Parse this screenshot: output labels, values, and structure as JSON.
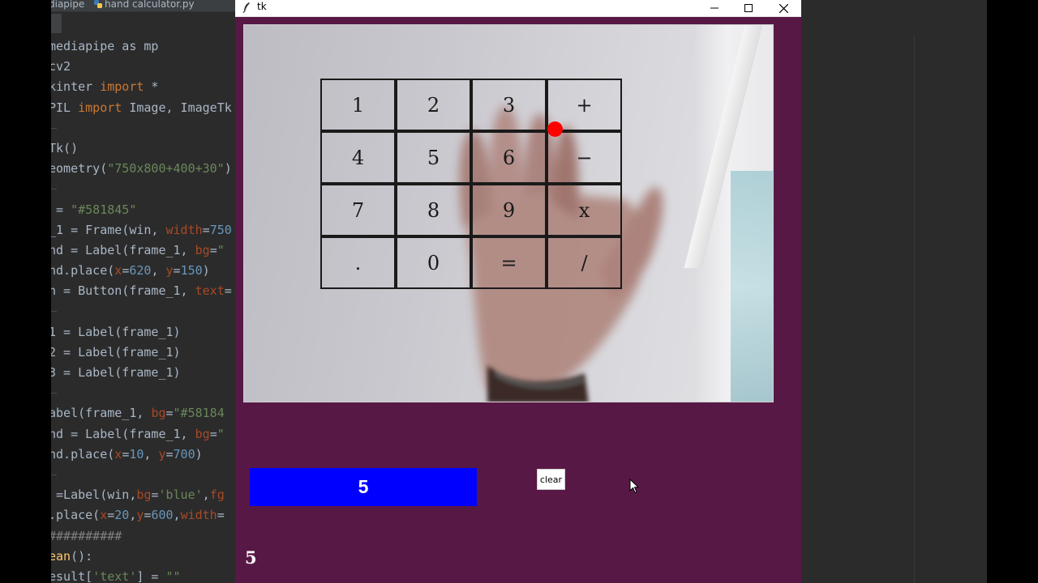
{
  "ide": {
    "tabs": [
      "diapipe",
      "hand calculator.py"
    ],
    "code_lines": [
      [
        [
          "mediapipe as mp",
          "plain"
        ],
        [
          "",
          ""
        ]
      ],
      [
        [
          "cv2",
          "plain"
        ]
      ],
      [
        [
          "kinter ",
          "plain"
        ],
        [
          "import",
          "kw"
        ],
        [
          " *",
          "plain"
        ]
      ],
      [
        [
          "PIL ",
          "plain"
        ],
        [
          "import",
          "kw"
        ],
        [
          " Image, ImageTk",
          "plain"
        ]
      ],
      [],
      [
        [
          "Tk()",
          "plain"
        ]
      ],
      [
        [
          "eometry(",
          "plain"
        ],
        [
          "\"750x800+400+30\"",
          "str"
        ],
        [
          ")",
          "plain"
        ]
      ],
      [],
      [
        [
          " = ",
          "plain"
        ],
        [
          "\"#581845\"",
          "str"
        ]
      ],
      [
        [
          "_1 = Frame(win, ",
          "plain"
        ],
        [
          "width",
          "param"
        ],
        [
          "=",
          "plain"
        ],
        [
          "750",
          "num"
        ]
      ],
      [
        [
          "nd = Label(frame_1, ",
          "plain"
        ],
        [
          "bg",
          "param"
        ],
        [
          "=",
          "plain"
        ],
        [
          "\"",
          "str"
        ]
      ],
      [
        [
          "nd.place(",
          "plain"
        ],
        [
          "x",
          "param"
        ],
        [
          "=",
          "plain"
        ],
        [
          "620",
          "num"
        ],
        [
          ", ",
          "plain"
        ],
        [
          "y",
          "param"
        ],
        [
          "=",
          "plain"
        ],
        [
          "150",
          "num"
        ],
        [
          ")",
          "plain"
        ]
      ],
      [
        [
          "n = Button(frame_1, ",
          "plain"
        ],
        [
          "text",
          "param"
        ],
        [
          "=",
          "plain"
        ]
      ],
      [],
      [
        [
          "1 = Label(frame_1)",
          "plain"
        ]
      ],
      [
        [
          "2 = Label(frame_1)",
          "plain"
        ]
      ],
      [
        [
          "3 = Label(frame_1)",
          "plain"
        ]
      ],
      [],
      [
        [
          "abel(frame_1, ",
          "plain"
        ],
        [
          "bg",
          "param"
        ],
        [
          "=",
          "plain"
        ],
        [
          "\"#58184",
          "str"
        ]
      ],
      [
        [
          "nd = Label(frame_1, ",
          "plain"
        ],
        [
          "bg",
          "param"
        ],
        [
          "=",
          "plain"
        ],
        [
          "\"",
          "str"
        ]
      ],
      [
        [
          "nd.place(",
          "plain"
        ],
        [
          "x",
          "param"
        ],
        [
          "=",
          "plain"
        ],
        [
          "10",
          "num"
        ],
        [
          ", ",
          "plain"
        ],
        [
          "y",
          "param"
        ],
        [
          "=",
          "plain"
        ],
        [
          "700",
          "num"
        ],
        [
          ")",
          "plain"
        ]
      ],
      [],
      [
        [
          " =Label(win,",
          "plain"
        ],
        [
          "bg",
          "param"
        ],
        [
          "=",
          "plain"
        ],
        [
          "'blue'",
          "str"
        ],
        [
          ",",
          "plain"
        ],
        [
          "fg",
          "param"
        ]
      ],
      [
        [
          ".place(",
          "plain"
        ],
        [
          "x",
          "param"
        ],
        [
          "=",
          "plain"
        ],
        [
          "20",
          "num"
        ],
        [
          ",",
          "plain"
        ],
        [
          "y",
          "param"
        ],
        [
          "=",
          "plain"
        ],
        [
          "600",
          "num"
        ],
        [
          ",",
          "plain"
        ],
        [
          "width",
          "param"
        ],
        [
          "=",
          "plain"
        ]
      ],
      [
        [
          "##########",
          "cmt"
        ]
      ],
      [
        [
          "ean",
          "fn"
        ],
        [
          "():",
          "plain"
        ]
      ],
      [
        [
          "esult[",
          "plain"
        ],
        [
          "'text'",
          "str"
        ],
        [
          "] = ",
          "plain"
        ],
        [
          "\"\"",
          "str"
        ]
      ]
    ]
  },
  "window": {
    "title": "tk"
  },
  "calculator": {
    "keys": [
      "1",
      "2",
      "3",
      "+",
      "4",
      "5",
      "6",
      "−",
      "7",
      "8",
      "9",
      "x",
      ".",
      "0",
      "=",
      "/"
    ]
  },
  "result": {
    "value": "5",
    "clear_label": "clear",
    "bottom_value": "5"
  },
  "colors": {
    "frame_bg": "#581845",
    "result_bg": "#0000ff",
    "fingertip": "#ff0000"
  }
}
